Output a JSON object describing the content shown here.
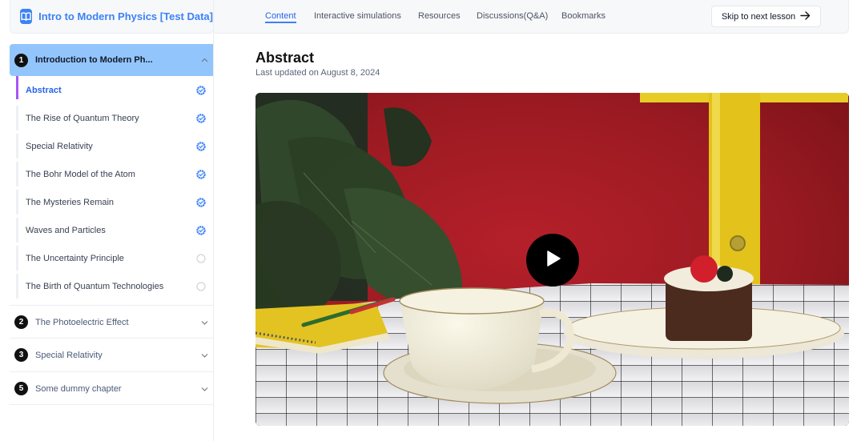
{
  "course": {
    "title": "Intro to Modern Physics [Test Data]",
    "icon": "open-book-icon"
  },
  "nav": {
    "tabs": [
      {
        "label": "Content",
        "active": true
      },
      {
        "label": "Interactive simulations",
        "active": false
      },
      {
        "label": "Resources",
        "active": false
      },
      {
        "label": "Discussions(Q&A)",
        "active": false
      },
      {
        "label": "Bookmarks",
        "active": false
      }
    ],
    "skip_label": "Skip to next lesson",
    "skip_icon": "arrow-right-icon"
  },
  "sidebar": {
    "chapters": [
      {
        "number": "1",
        "title": "Introduction to Modern Ph...",
        "expanded": true,
        "lessons": [
          {
            "title": "Abstract",
            "completed": true,
            "active": true
          },
          {
            "title": "The Rise of Quantum Theory",
            "completed": true,
            "active": false
          },
          {
            "title": "Special Relativity",
            "completed": true,
            "active": false
          },
          {
            "title": "The Bohr Model of the Atom",
            "completed": true,
            "active": false
          },
          {
            "title": "The Mysteries Remain",
            "completed": true,
            "active": false
          },
          {
            "title": "Waves and Particles",
            "completed": true,
            "active": false
          },
          {
            "title": "The Uncertainty Principle",
            "completed": false,
            "active": false
          },
          {
            "title": "The Birth of Quantum Technologies",
            "completed": false,
            "active": false
          }
        ]
      },
      {
        "number": "2",
        "title": "The Photoelectric Effect",
        "expanded": false
      },
      {
        "number": "3",
        "title": "Special Relativity",
        "expanded": false
      },
      {
        "number": "5",
        "title": "Some dummy chapter",
        "expanded": false
      }
    ]
  },
  "main": {
    "title": "Abstract",
    "updated": "Last updated on August 8, 2024",
    "video": {
      "play_icon": "play-icon",
      "scene": "teacup, cake, notebook and yellow lamp on a grid tablecloth in front of a red wall"
    }
  },
  "colors": {
    "accent": "#3b82f6",
    "active_chapter_bg": "#93c5fd",
    "active_lesson_marker": "#a855f7"
  }
}
